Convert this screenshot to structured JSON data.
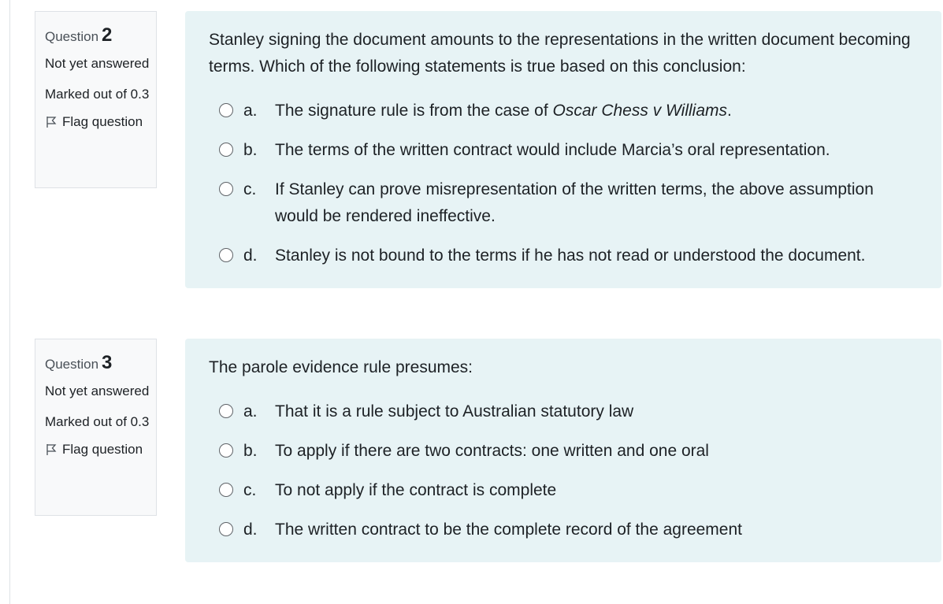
{
  "questions": [
    {
      "label": "Question",
      "number": "2",
      "state": "Not yet answered",
      "grade": "Marked out of 0.3",
      "flag_label": "Flag question",
      "text": "Stanley signing the document amounts to the representations in the written document becoming terms. Which of the following statements is true based on this conclusion:",
      "options": [
        {
          "letter": "a.",
          "text_before": "The signature rule is from the case of ",
          "text_italic": "Oscar Chess v Williams",
          "text_after": "."
        },
        {
          "letter": "b.",
          "text_before": "The terms of the written contract would include Marcia’s oral representation.",
          "text_italic": "",
          "text_after": ""
        },
        {
          "letter": "c.",
          "text_before": "If Stanley can prove misrepresentation of the written terms, the above assumption would be rendered ineffective.",
          "text_italic": "",
          "text_after": ""
        },
        {
          "letter": "d.",
          "text_before": "Stanley is not bound to the terms if he has not read or understood the document.",
          "text_italic": "",
          "text_after": ""
        }
      ]
    },
    {
      "label": "Question",
      "number": "3",
      "state": "Not yet answered",
      "grade": "Marked out of 0.3",
      "flag_label": "Flag question",
      "text": "The parole evidence rule presumes:",
      "options": [
        {
          "letter": "a.",
          "text_before": "That it is a rule subject to Australian statutory law",
          "text_italic": "",
          "text_after": ""
        },
        {
          "letter": "b.",
          "text_before": "To apply if there are two contracts: one written and one oral",
          "text_italic": "",
          "text_after": ""
        },
        {
          "letter": "c.",
          "text_before": "To not apply if the contract is complete",
          "text_italic": "",
          "text_after": ""
        },
        {
          "letter": "d.",
          "text_before": "The written contract to be the complete record of the agreement",
          "text_italic": "",
          "text_after": ""
        }
      ]
    }
  ]
}
